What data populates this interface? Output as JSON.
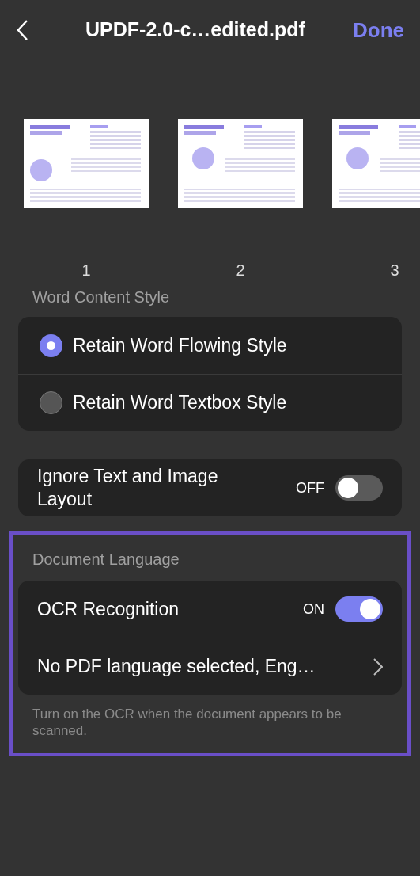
{
  "header": {
    "title": "UPDF-2.0-c…edited.pdf",
    "done": "Done"
  },
  "pages": [
    {
      "number": "1"
    },
    {
      "number": "2"
    },
    {
      "number": "3"
    }
  ],
  "word_content_style": {
    "label": "Word Content Style",
    "options": [
      {
        "label": "Retain Word Flowing Style",
        "selected": true
      },
      {
        "label": "Retain Word Textbox Style",
        "selected": false
      }
    ]
  },
  "layout_toggle": {
    "label": "Ignore Text and Image Layout",
    "state": "OFF",
    "on": false
  },
  "document_language": {
    "label": "Document Language",
    "highlighted": true,
    "ocr": {
      "label": "OCR Recognition",
      "state": "ON",
      "on": true
    },
    "language": {
      "label": "No PDF language selected, Eng…"
    },
    "hint": "Turn on the OCR when the document appears to be scanned."
  }
}
